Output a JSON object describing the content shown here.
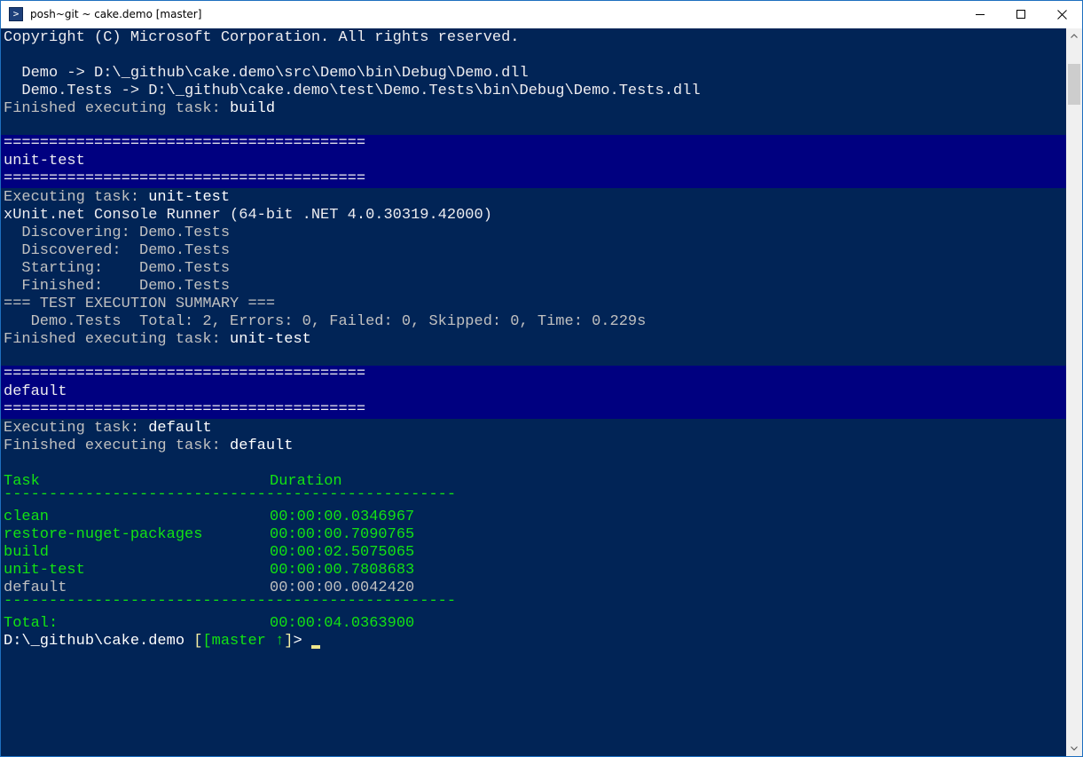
{
  "window": {
    "title": "posh~git ~ cake.demo [master]",
    "icon": "powershell-icon"
  },
  "colors": {
    "background": "#012456",
    "banner": "#000080",
    "text": "#eeedf0",
    "gray": "#c0c0c0",
    "green": "#13e213",
    "titlebar": "#ffffff"
  },
  "console": {
    "copyright": "Copyright (C) Microsoft Corporation. All rights reserved.",
    "build_out_1": "  Demo -> D:\\_github\\cake.demo\\src\\Demo\\bin\\Debug\\Demo.dll",
    "build_out_2": "  Demo.Tests -> D:\\_github\\cake.demo\\test\\Demo.Tests\\bin\\Debug\\Demo.Tests.dll",
    "finished_prefix": "Finished executing task: ",
    "executing_prefix": "Executing task: ",
    "separator": "========================================",
    "build_task": "build",
    "unit_test_task": "unit-test",
    "default_task": "default",
    "xunit_header": "xUnit.net Console Runner (64-bit .NET 4.0.30319.42000)",
    "xunit_lines": [
      "  Discovering: Demo.Tests",
      "  Discovered:  Demo.Tests",
      "  Starting:    Demo.Tests",
      "  Finished:    Demo.Tests"
    ],
    "summary_header": "=== TEST EXECUTION SUMMARY ===",
    "summary_line": "   Demo.Tests  Total: 2, Errors: 0, Failed: 0, Skipped: 0, Time: 0.229s"
  },
  "report": {
    "header_task": "Task",
    "header_duration": "Duration",
    "divider": "--------------------------------------------------",
    "rows": [
      {
        "task": "clean",
        "duration": "00:00:00.0346967",
        "color": "green"
      },
      {
        "task": "restore-nuget-packages",
        "duration": "00:00:00.7090765",
        "color": "green"
      },
      {
        "task": "build",
        "duration": "00:00:02.5075065",
        "color": "green"
      },
      {
        "task": "unit-test",
        "duration": "00:00:00.7808683",
        "color": "green"
      },
      {
        "task": "default",
        "duration": "00:00:00.0042420",
        "color": "gray"
      }
    ],
    "total_label": "Total:",
    "total_duration": "00:00:04.0363900"
  },
  "prompt": {
    "path": "D:\\_github\\cake.demo ",
    "branch_open": "[master ",
    "ahead_icon": "↑",
    "branch_close": "]",
    "suffix": "> "
  }
}
